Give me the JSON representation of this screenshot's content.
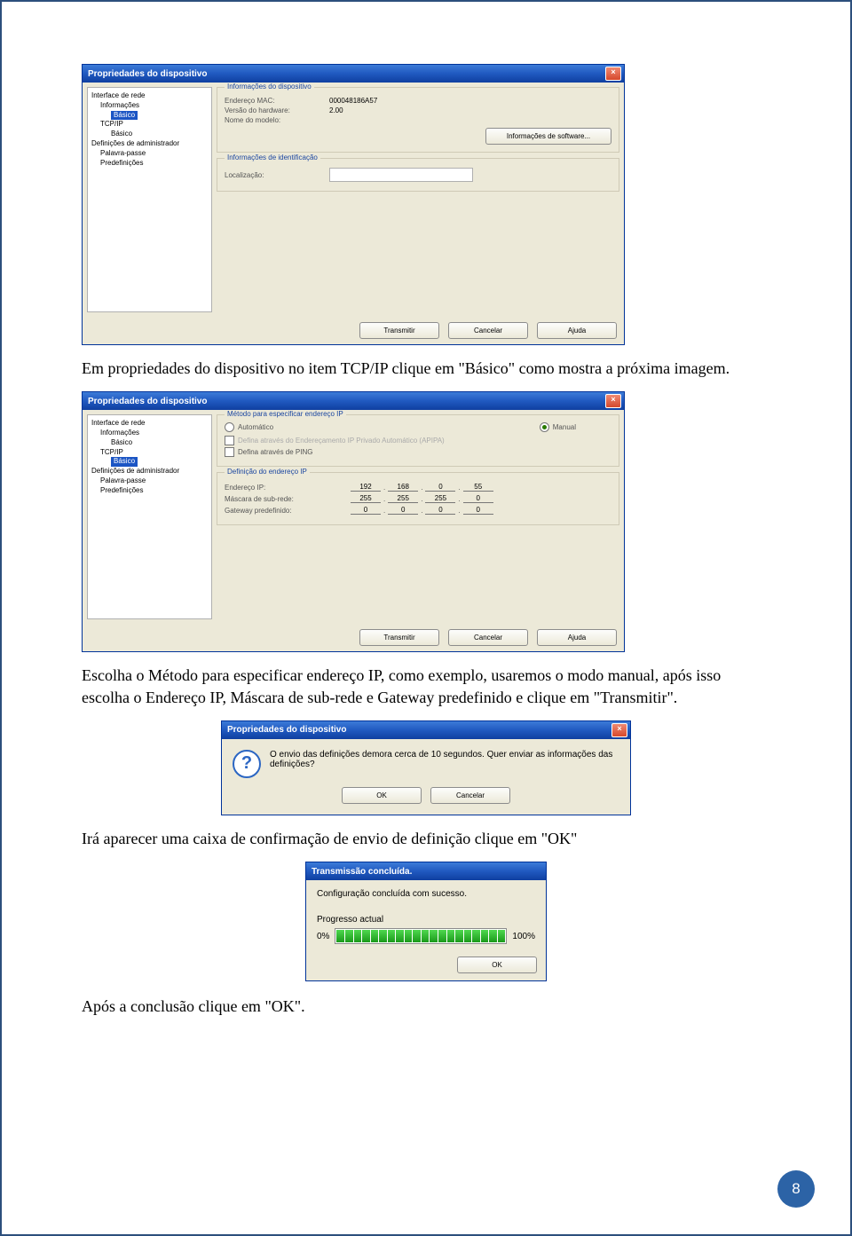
{
  "page_number": "8",
  "text": {
    "p1": "Em propriedades do dispositivo no item TCP/IP clique em \"Básico\" como mostra a próxima imagem.",
    "p2": "Escolha o Método para especificar endereço IP, como exemplo, usaremos o modo manual, após isso escolha o Endereço IP, Máscara de sub-rede e Gateway predefinido e clique em \"Transmitir\".",
    "p3": "Irá aparecer uma caixa de confirmação de envio de definição clique em \"OK\"",
    "p4": "Após a conclusão clique em \"OK\"."
  },
  "win1": {
    "title": "Propriedades do dispositivo",
    "tree": [
      {
        "l": 0,
        "t": "Interface de rede"
      },
      {
        "l": 1,
        "t": "Informações"
      },
      {
        "l": 2,
        "t": "Básico",
        "sel": true
      },
      {
        "l": 1,
        "t": "TCP/IP"
      },
      {
        "l": 2,
        "t": "Básico"
      },
      {
        "l": 0,
        "t": "Definições de administrador"
      },
      {
        "l": 1,
        "t": "Palavra-passe"
      },
      {
        "l": 1,
        "t": "Predefinições"
      }
    ],
    "group_info": "Informações do dispositivo",
    "mac_label": "Endereço MAC:",
    "mac_value": "000048186A57",
    "hw_label": "Versão do hardware:",
    "hw_value": "2.00",
    "model_label": "Nome do modelo:",
    "sw_btn": "Informações de software...",
    "group_id": "Informações de identificação",
    "loc_label": "Localização:",
    "btn_transmit": "Transmitir",
    "btn_cancel": "Cancelar",
    "btn_help": "Ajuda"
  },
  "win2": {
    "title": "Propriedades do dispositivo",
    "tree": [
      {
        "l": 0,
        "t": "Interface de rede"
      },
      {
        "l": 1,
        "t": "Informações"
      },
      {
        "l": 2,
        "t": "Básico"
      },
      {
        "l": 1,
        "t": "TCP/IP"
      },
      {
        "l": 2,
        "t": "Básico",
        "sel": true
      },
      {
        "l": 0,
        "t": "Definições de administrador"
      },
      {
        "l": 1,
        "t": "Palavra-passe"
      },
      {
        "l": 1,
        "t": "Predefinições"
      }
    ],
    "group_method": "Método para especificar endereço IP",
    "radio_auto": "Automático",
    "radio_manual": "Manual",
    "chk_apipa": "Defina através do Endereçamento IP Privado Automático (APIPA)",
    "chk_ping": "Defina através de PING",
    "group_def": "Definição do endereço IP",
    "ip_label": "Endereço IP:",
    "ip": [
      "192",
      "168",
      "0",
      "55"
    ],
    "mask_label": "Máscara de sub-rede:",
    "mask": [
      "255",
      "255",
      "255",
      "0"
    ],
    "gw_label": "Gateway predefinido:",
    "gw": [
      "0",
      "0",
      "0",
      "0"
    ],
    "btn_transmit": "Transmitir",
    "btn_cancel": "Cancelar",
    "btn_help": "Ajuda"
  },
  "confirm": {
    "title": "Propriedades do dispositivo",
    "message": "O envio das definições demora cerca de 10 segundos. Quer enviar as informações das definições?",
    "ok": "OK",
    "cancel": "Cancelar"
  },
  "trans": {
    "title": "Transmissão concluída.",
    "msg": "Configuração concluída com sucesso.",
    "progress_label": "Progresso actual",
    "pct0": "0%",
    "pct100": "100%",
    "ok": "OK"
  }
}
